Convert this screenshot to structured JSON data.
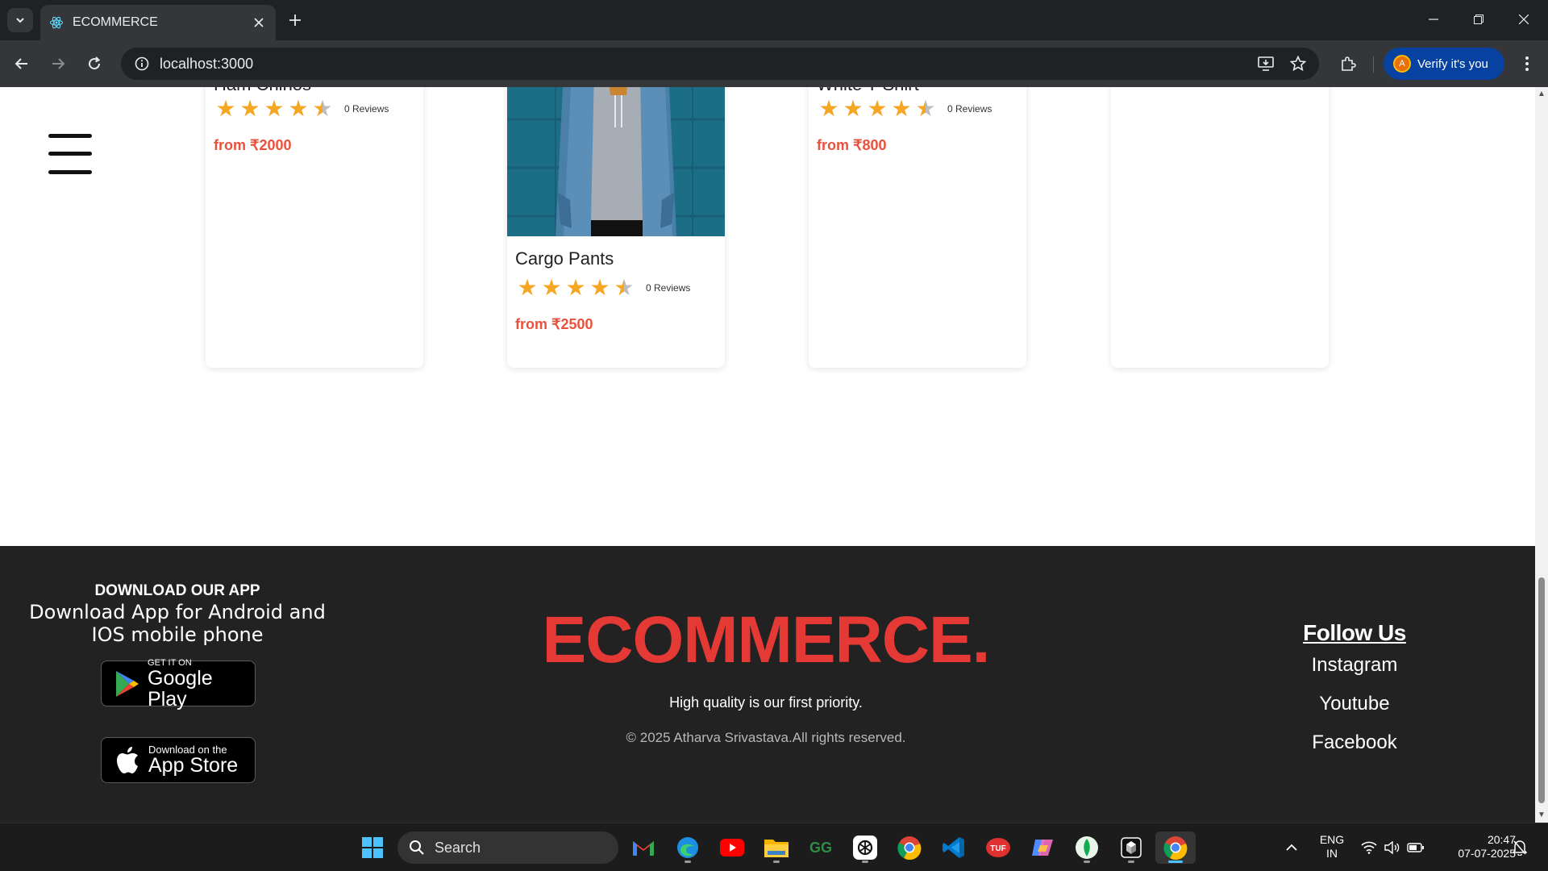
{
  "browser": {
    "tab_title": "ECOMMERCE",
    "url": "localhost:3000",
    "verify_label": "Verify it's you",
    "profile_initial": "A"
  },
  "products": [
    {
      "name": "Ham Chinos",
      "reviews": "0 Reviews",
      "price": "from ₹2000",
      "rating": 4.5
    },
    {
      "name": "Cargo Pants",
      "reviews": "0 Reviews",
      "price": "from ₹2500",
      "rating": 4.5
    },
    {
      "name": "White T-Shirt",
      "reviews": "0 Reviews",
      "price": "from ₹800",
      "rating": 4.5
    }
  ],
  "footer": {
    "download_title": "DOWNLOAD OUR APP",
    "download_text": "Download App for Android and IOS mobile phone",
    "google_play": {
      "small": "GET IT ON",
      "big": "Google Play"
    },
    "app_store": {
      "small": "Download on the",
      "big": "App Store"
    },
    "brand": "ECOMMERCE.",
    "tagline": "High quality is our first priority.",
    "copyright": "© 2025 Atharva Srivastava.All rights reserved.",
    "follow_title": "Follow Us",
    "social": [
      "Instagram",
      "Youtube",
      "Facebook"
    ]
  },
  "taskbar": {
    "search_label": "Search",
    "lang_top": "ENG",
    "lang_bottom": "IN",
    "time": "20:47",
    "date": "07-07-2025"
  },
  "colors": {
    "brand_red": "#e53935",
    "price_red": "#e8523d",
    "star_gold": "#f5a623",
    "footer_bg": "#222222",
    "verify_blue": "#0842a0"
  }
}
